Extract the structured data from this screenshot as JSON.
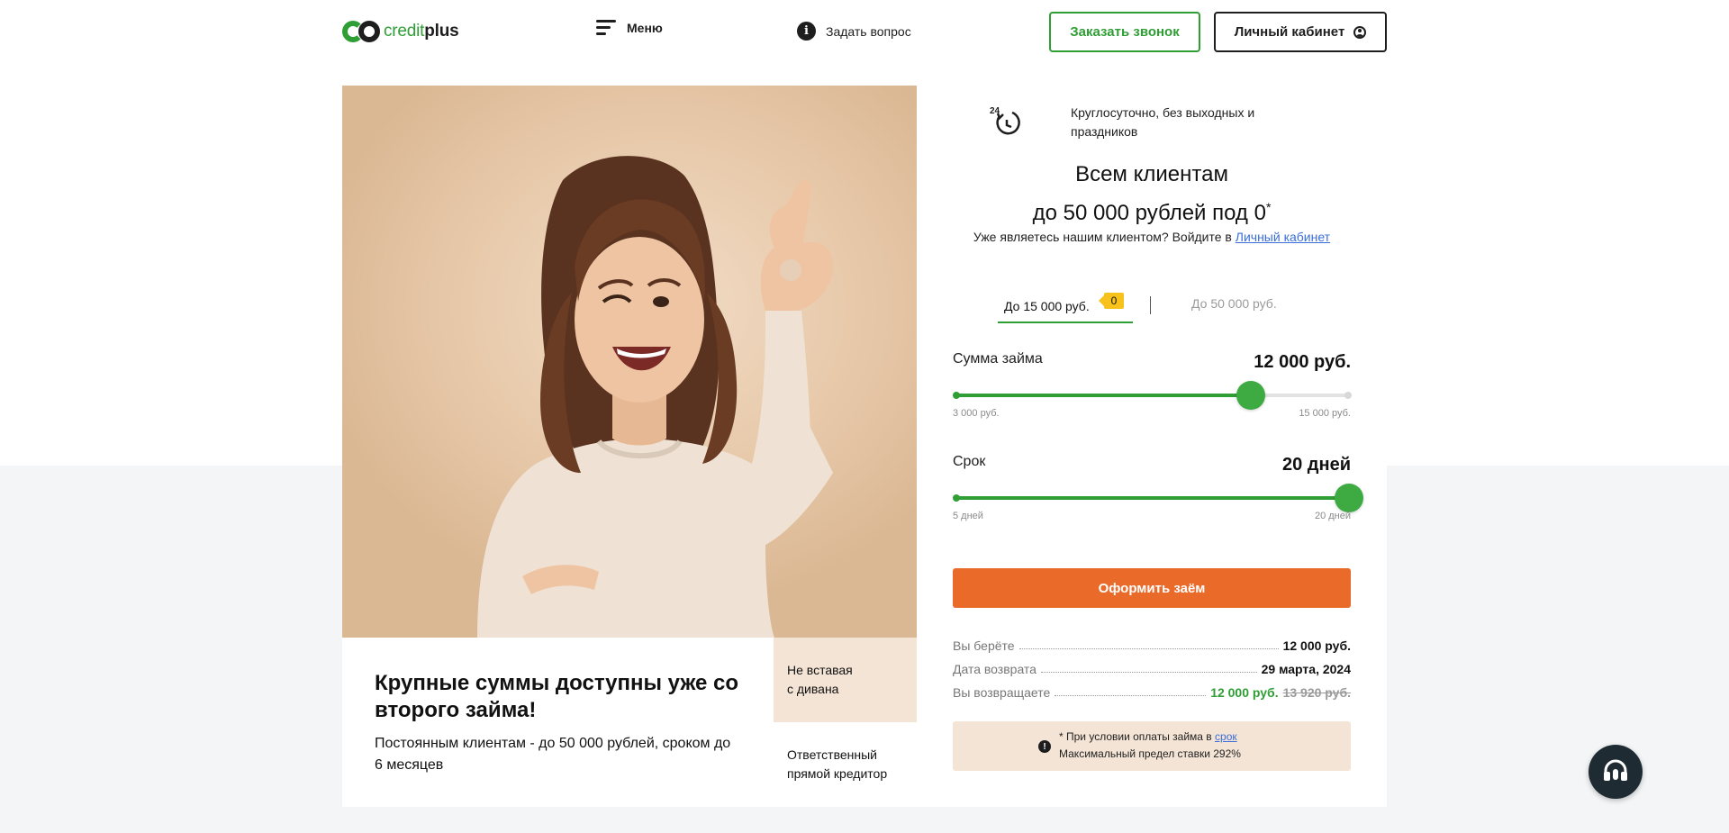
{
  "header": {
    "logo_prefix": "credit",
    "logo_suffix": "plus",
    "menu_label": "Меню",
    "ask_label": "Задать вопрос",
    "call_label": "Заказать звонок",
    "cabinet_label": "Личный кабинет"
  },
  "promo": {
    "title": "Крупные суммы доступны уже со второго займа!",
    "text": "Постоянным клиентам - до 50 000 рублей, сроком до 6 месяцев"
  },
  "features": [
    {
      "line1": "Не вставая",
      "line2": "с дивана"
    },
    {
      "line1": "Ответственный",
      "line2": "прямой кредитор"
    }
  ],
  "calculator": {
    "availability_line1": "Круглосуточно, без выходных и",
    "availability_line2": "праздников",
    "clock_label": "24",
    "headline_line1": "Всем клиентам",
    "headline_line2": "до 50 000 рублей под 0",
    "headline_mark": "*",
    "login_prefix": "Уже являетесь нашим клиентом? Войдите в ",
    "login_link": "Личный кабинет",
    "tabs": [
      {
        "label": "До 15 000 руб.",
        "badge": "0",
        "active": true
      },
      {
        "label": "До 50 000 руб.",
        "active": false
      }
    ],
    "amount": {
      "label": "Сумма займа",
      "value": "12 000 руб.",
      "min": "3 000 руб.",
      "max": "15 000 руб.",
      "level": 0.75
    },
    "term": {
      "label": "Срок",
      "value": "20 дней",
      "min": "5 дней",
      "max": "20 дней",
      "level": 1.0
    },
    "submit_label": "Оформить заём",
    "summary": {
      "borrow_label": "Вы берёте",
      "borrow_value": "12 000 руб.",
      "date_label": "Дата возврата",
      "date_value": "29 марта, 2024",
      "return_label": "Вы возвращаете",
      "return_value": "12 000 руб.",
      "return_old": "13 920 руб."
    },
    "notice_prefix": "* При условии оплаты займа в ",
    "notice_link": "срок",
    "notice_line2": "Максимальный предел ставки 292%"
  },
  "colors": {
    "brand_green": "#2f9e34",
    "accent_orange": "#ea6a2a",
    "badge_yellow": "#f6c21b",
    "beige": "#f4e4d5"
  },
  "icons": [
    "hamburger-icon",
    "info-icon",
    "user-icon",
    "clock-24-icon",
    "alert-icon",
    "headset-icon"
  ]
}
